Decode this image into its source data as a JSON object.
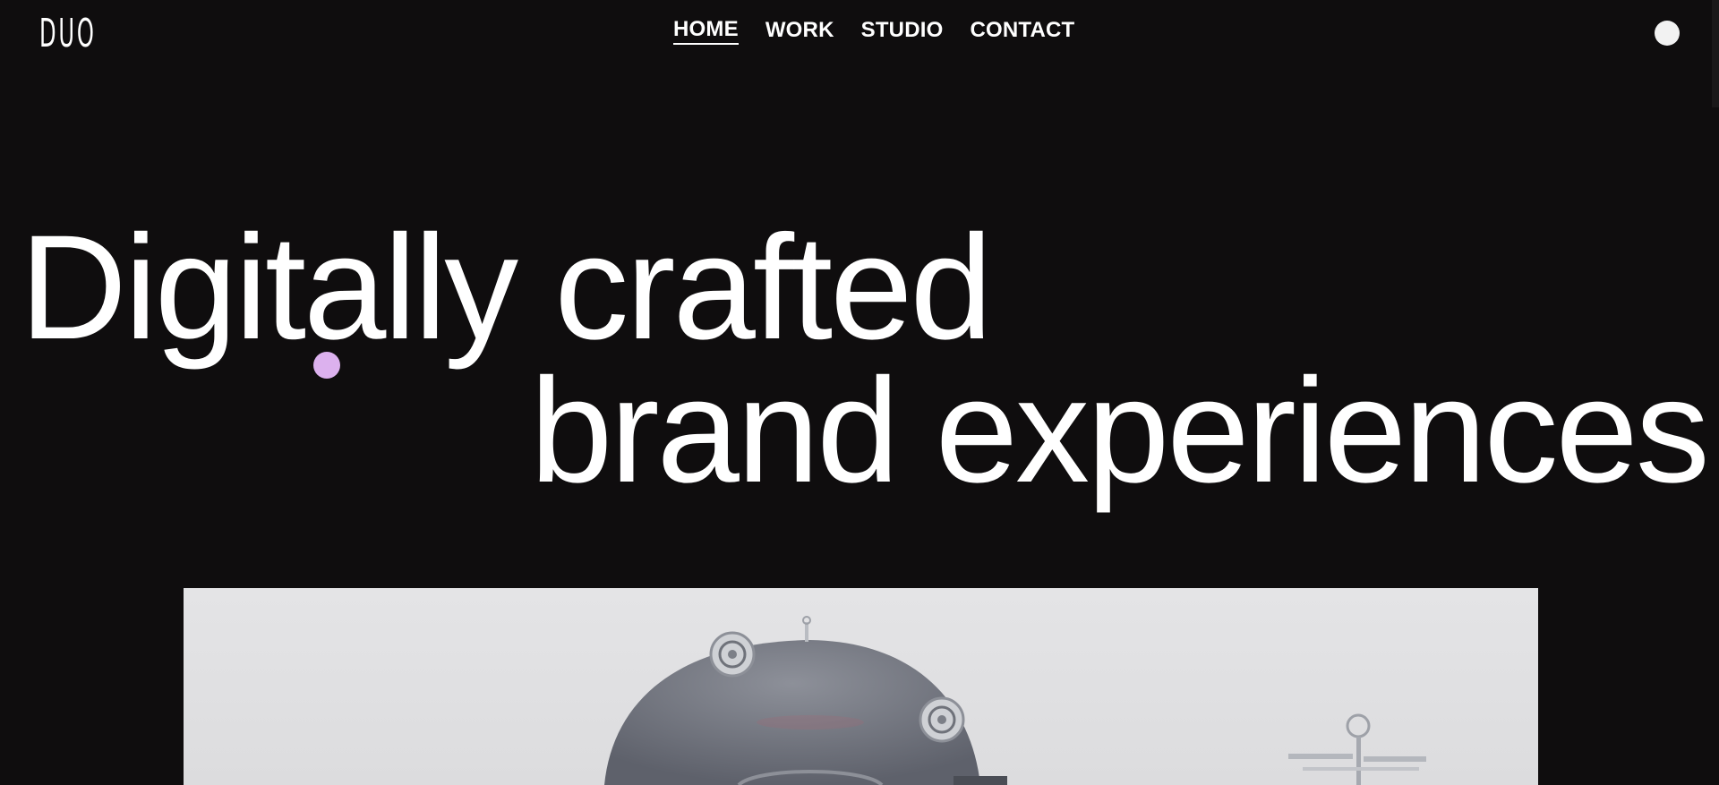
{
  "header": {
    "logo": "DUO",
    "nav": [
      {
        "label": "HOME",
        "active": true
      },
      {
        "label": "WORK",
        "active": false
      },
      {
        "label": "STUDIO",
        "active": false
      },
      {
        "label": "CONTACT",
        "active": false
      }
    ],
    "menu_icon": "circle-menu-icon"
  },
  "hero": {
    "line1": "Digitally crafted",
    "line2": "brand experiences",
    "accent_color": "#dcb1ee"
  },
  "media": {
    "icon": "machine-image"
  },
  "colors": {
    "background": "#0f0d0e",
    "text": "#ffffff"
  }
}
